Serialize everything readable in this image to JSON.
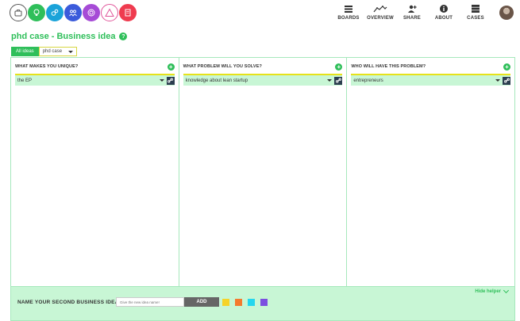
{
  "header": {
    "logos": [
      {
        "icon": "briefcase-icon",
        "bg": "#ffffff",
        "border": "#555555"
      },
      {
        "icon": "lightbulb-icon",
        "bg": "#2fbf5a",
        "border": "#2fbf5a"
      },
      {
        "icon": "gears-icon",
        "bg": "#1aa3d9",
        "border": "#1aa3d9"
      },
      {
        "icon": "people-icon",
        "bg": "#3b5bdb",
        "border": "#3b5bdb"
      },
      {
        "icon": "target-icon",
        "bg": "#a64bd6",
        "border": "#a64bd6"
      },
      {
        "icon": "triangle-warning-icon",
        "bg": "#ffffff",
        "border": "#e0569b"
      },
      {
        "icon": "document-icon",
        "bg": "#ef3b4f",
        "border": "#ef3b4f"
      }
    ],
    "nav": [
      {
        "icon": "boards-icon",
        "label": "BOARDS"
      },
      {
        "icon": "overview-icon",
        "label": "OVERVIEW"
      },
      {
        "icon": "share-icon",
        "label": "SHARE"
      },
      {
        "icon": "info-icon",
        "label": "ABOUT"
      },
      {
        "icon": "cases-icon",
        "label": "CASES"
      }
    ]
  },
  "page": {
    "title": "phd case - Business idea",
    "help_glyph": "?"
  },
  "filters": {
    "all_ideas_label": "All ideas",
    "case_selected": "phd case"
  },
  "columns": [
    {
      "title": "WHAT MAKES YOU UNIQUE?",
      "items": [
        {
          "text": "the EP"
        }
      ]
    },
    {
      "title": "WHAT PROBLEM WILL YOU SOLVE?",
      "items": [
        {
          "text": "knowledge about lean startup"
        }
      ]
    },
    {
      "title": "WHO WILL HAVE THIS PROBLEM?",
      "items": [
        {
          "text": "entrepreneurs"
        }
      ]
    }
  ],
  "helper": {
    "hide_label": "Hide helper",
    "prompt": "NAME YOUR SECOND BUSINESS IDEA!",
    "input_placeholder": "Give the new idea name!",
    "add_label": "ADD",
    "swatches": [
      "#f5d328",
      "#f47a2e",
      "#24d6ee",
      "#7b4fe0"
    ]
  },
  "colors": {
    "accent": "#2fbf5a",
    "item_bg": "#c8f6d5",
    "highlight": "#e6e21a"
  }
}
